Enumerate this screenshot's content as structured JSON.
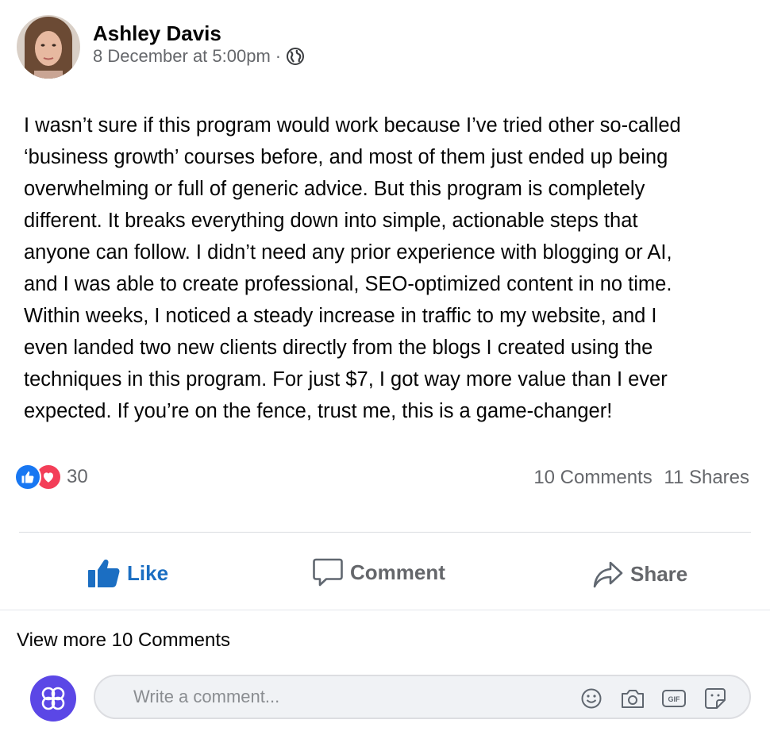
{
  "post": {
    "author": "Ashley Davis",
    "timestamp": "8 December at 5:00pm",
    "separator": "·",
    "audience_icon": "globe-icon",
    "body": "I wasn’t sure if this program would work because I’ve tried other so-called\n‘business growth’ courses before, and most of them just ended up being\noverwhelming or full of generic advice. But this program is completely\ndifferent. It breaks everything down into simple, actionable steps that\nanyone can follow. I didn’t need any prior experience with blogging or AI,\nand I was able to create professional, SEO-optimized content in no time.\nWithin weeks, I noticed a steady increase in traffic to my website, and I\neven landed two new clients directly from the blogs I created using the\ntechniques in this program. For just $7, I got way more value than I ever\nexpected. If you’re on the fence, trust me, this is a game-changer!"
  },
  "engagement": {
    "reaction_count": "30",
    "comments": "10 Comments",
    "shares": "11 Shares"
  },
  "actions": {
    "like": "Like",
    "comment": "Comment",
    "share": "Share"
  },
  "comments_section": {
    "view_more": "View more 10 Comments",
    "placeholder": "Write a comment..."
  },
  "colors": {
    "like_blue": "#1b6ec2",
    "love_red": "#f33e58",
    "composer_avatar": "#5b47e6"
  }
}
